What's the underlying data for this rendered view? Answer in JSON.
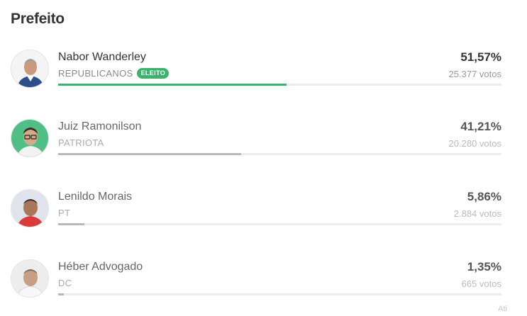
{
  "section_title": "Prefeito",
  "candidates": [
    {
      "name": "Nabor Wanderley",
      "party": "REPUBLICANOS",
      "badge": "ELEITO",
      "percent_label": "51,57%",
      "votes_label": "25.377 votos",
      "share": 0.5157
    },
    {
      "name": "Juiz Ramonilson",
      "party": "PATRIOTA",
      "badge": "",
      "percent_label": "41,21%",
      "votes_label": "20.280 votos",
      "share": 0.4121
    },
    {
      "name": "Lenildo Morais",
      "party": "PT",
      "badge": "",
      "percent_label": "5,86%",
      "votes_label": "2.884 votos",
      "share": 0.0586
    },
    {
      "name": "Héber Advogado",
      "party": "DC",
      "badge": "",
      "percent_label": "1,35%",
      "votes_label": "665 votos",
      "share": 0.0135
    }
  ],
  "footer_partial": "Ati"
}
